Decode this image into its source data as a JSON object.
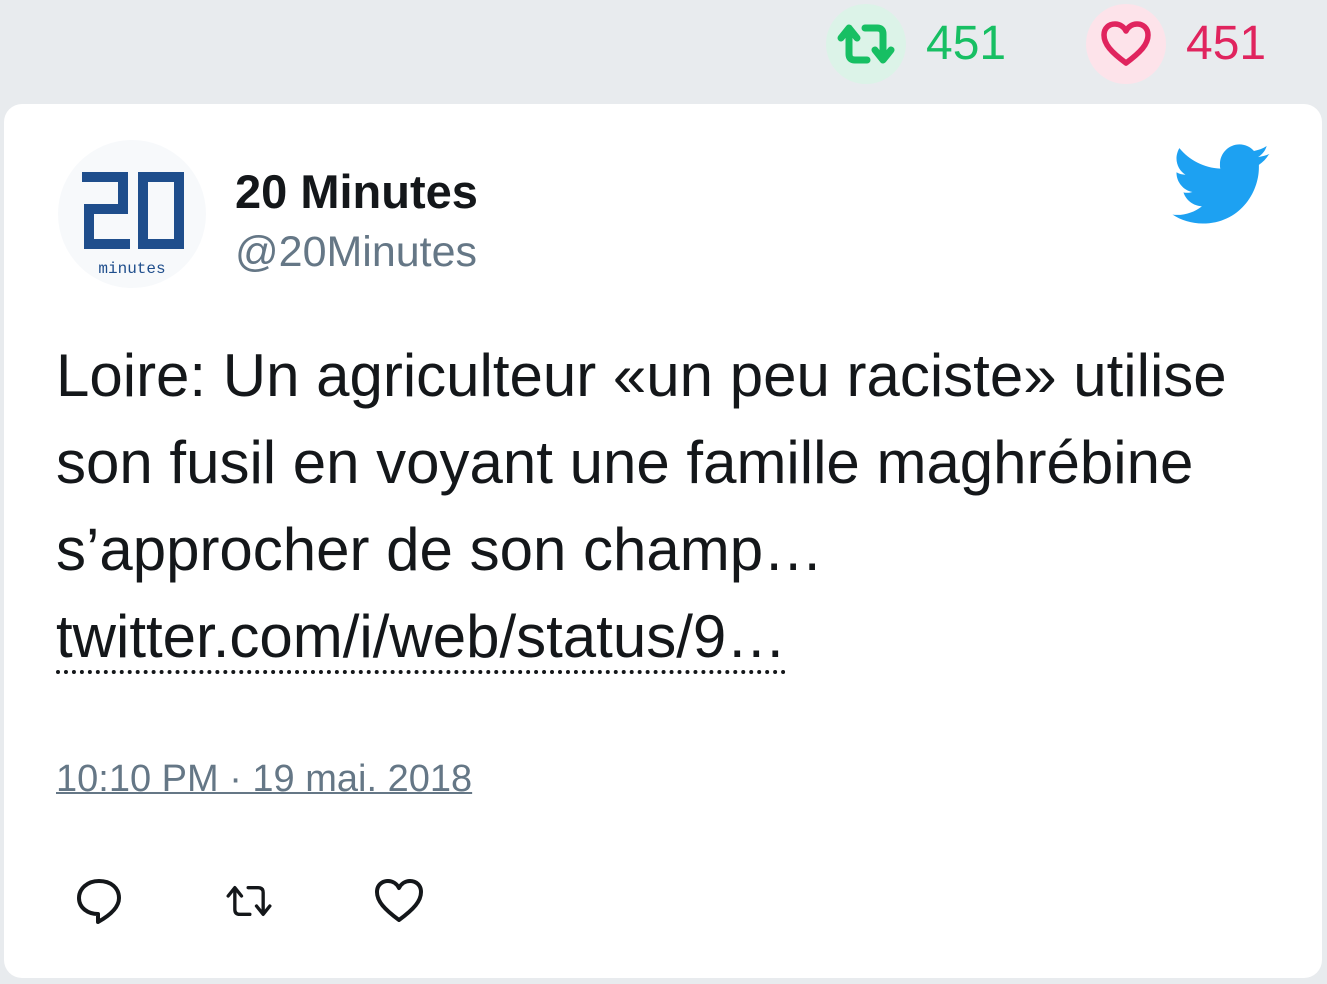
{
  "stats": {
    "retweets": {
      "count": "451",
      "icon": "retweet-icon",
      "color": "#17bf63"
    },
    "likes": {
      "count": "451",
      "icon": "heart-icon",
      "color": "#e0245e"
    }
  },
  "tweet": {
    "author": {
      "name": "20 Minutes",
      "handle": "@20Minutes",
      "avatar_text": "20",
      "avatar_subtext": "minutes"
    },
    "text_before_link": "Loire: Un agriculteur «un peu raciste» utilise son fusil en voyant une famille maghrébine s’approcher de son champ… ",
    "link_text": "twitter.com/i/web/status/9…",
    "timestamp": "10:10 PM · 19 mai. 2018",
    "actions": [
      "reply-icon",
      "retweet-icon",
      "like-icon"
    ]
  },
  "colors": {
    "twitter_blue": "#1da1f2",
    "text": "#14171a",
    "muted": "#657786",
    "avatar_blue": "#1f4e8c"
  }
}
